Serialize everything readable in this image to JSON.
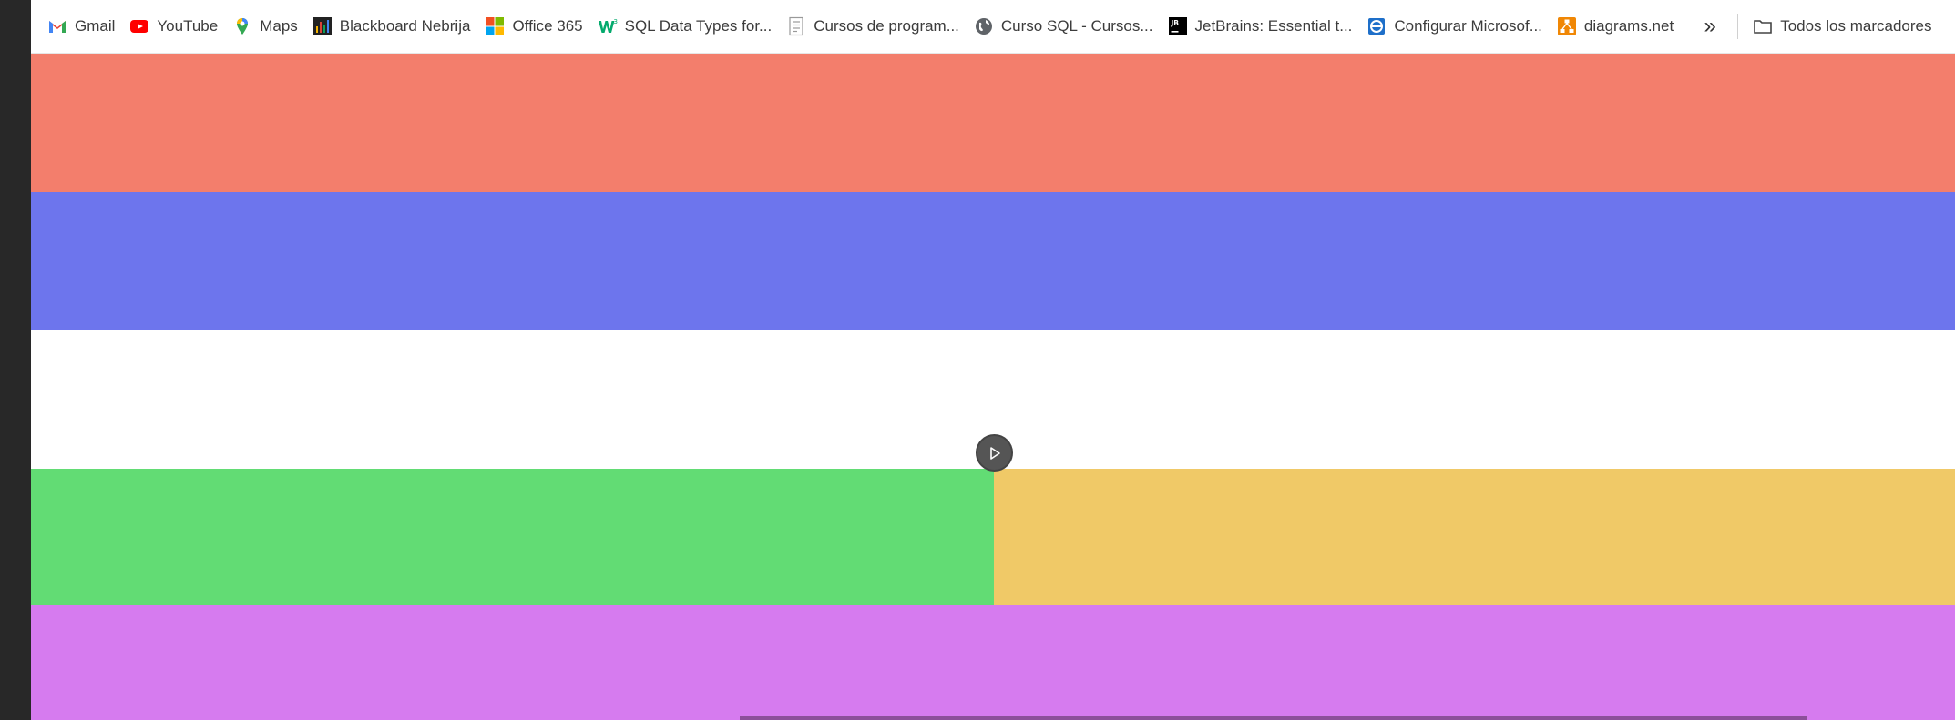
{
  "bookmarks": [
    {
      "label": "Gmail",
      "icon": "gmail-icon"
    },
    {
      "label": "YouTube",
      "icon": "youtube-icon"
    },
    {
      "label": "Maps",
      "icon": "maps-icon"
    },
    {
      "label": "Blackboard Nebrija",
      "icon": "blackboard-icon"
    },
    {
      "label": "Office 365",
      "icon": "office-icon"
    },
    {
      "label": "SQL Data Types for...",
      "icon": "w3schools-icon"
    },
    {
      "label": "Cursos de program...",
      "icon": "document-icon"
    },
    {
      "label": "Curso SQL - Cursos...",
      "icon": "globe-icon"
    },
    {
      "label": "JetBrains: Essential t...",
      "icon": "jetbrains-icon"
    },
    {
      "label": "Configurar Microsof...",
      "icon": "ie-icon"
    },
    {
      "label": "diagrams.net",
      "icon": "drawio-icon"
    }
  ],
  "overflow_label": "»",
  "all_bookmarks_label": "Todos los marcadores",
  "stripes": {
    "red": "#f37e6c",
    "blue": "#6d75ed",
    "white": "#ffffff",
    "green": "#62dc74",
    "yellow": "#f0c967",
    "purple": "#d67bef"
  }
}
